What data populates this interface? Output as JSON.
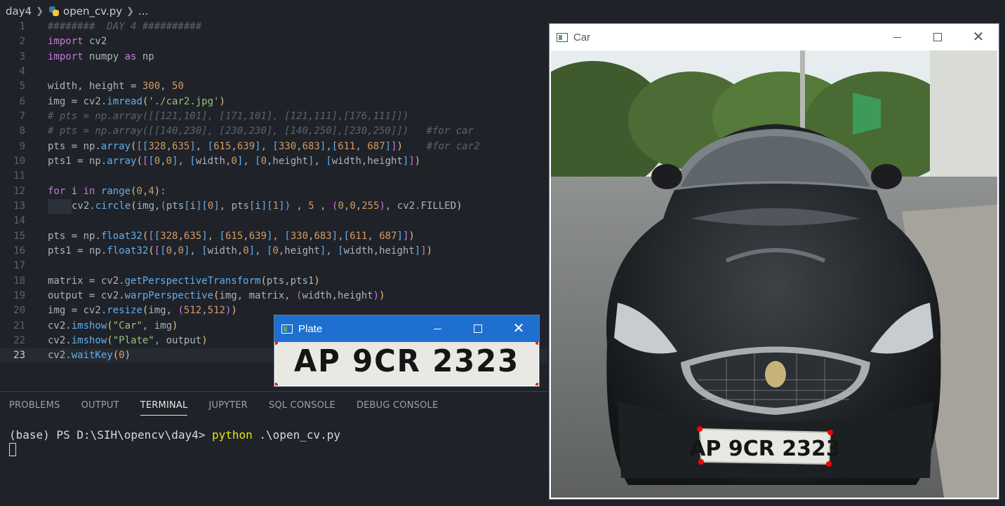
{
  "breadcrumb": {
    "folder": "day4",
    "file": "open_cv.py",
    "more": "..."
  },
  "editor": {
    "active_line": 23
  },
  "panel": {
    "tabs": [
      "PROBLEMS",
      "OUTPUT",
      "TERMINAL",
      "JUPYTER",
      "SQL CONSOLE",
      "DEBUG CONSOLE"
    ],
    "active_tab": "TERMINAL",
    "terminal_prompt": "(base) PS D:\\SIH\\opencv\\day4> ",
    "terminal_command": "python",
    "terminal_args": " .\\open_cv.py"
  },
  "car_window": {
    "title": "Car",
    "plate_text": "AP 9CR 2323"
  },
  "plate_window": {
    "title": "Plate",
    "plate_text": "AP 9CR 2323"
  },
  "colors": {
    "titlebar_active": "#1e6fd0",
    "marker": "#ff0000",
    "editor_bg": "#1f2228"
  },
  "icons": [
    "python-file-icon",
    "window-app-icon",
    "minimize-icon",
    "maximize-icon",
    "close-icon"
  ]
}
